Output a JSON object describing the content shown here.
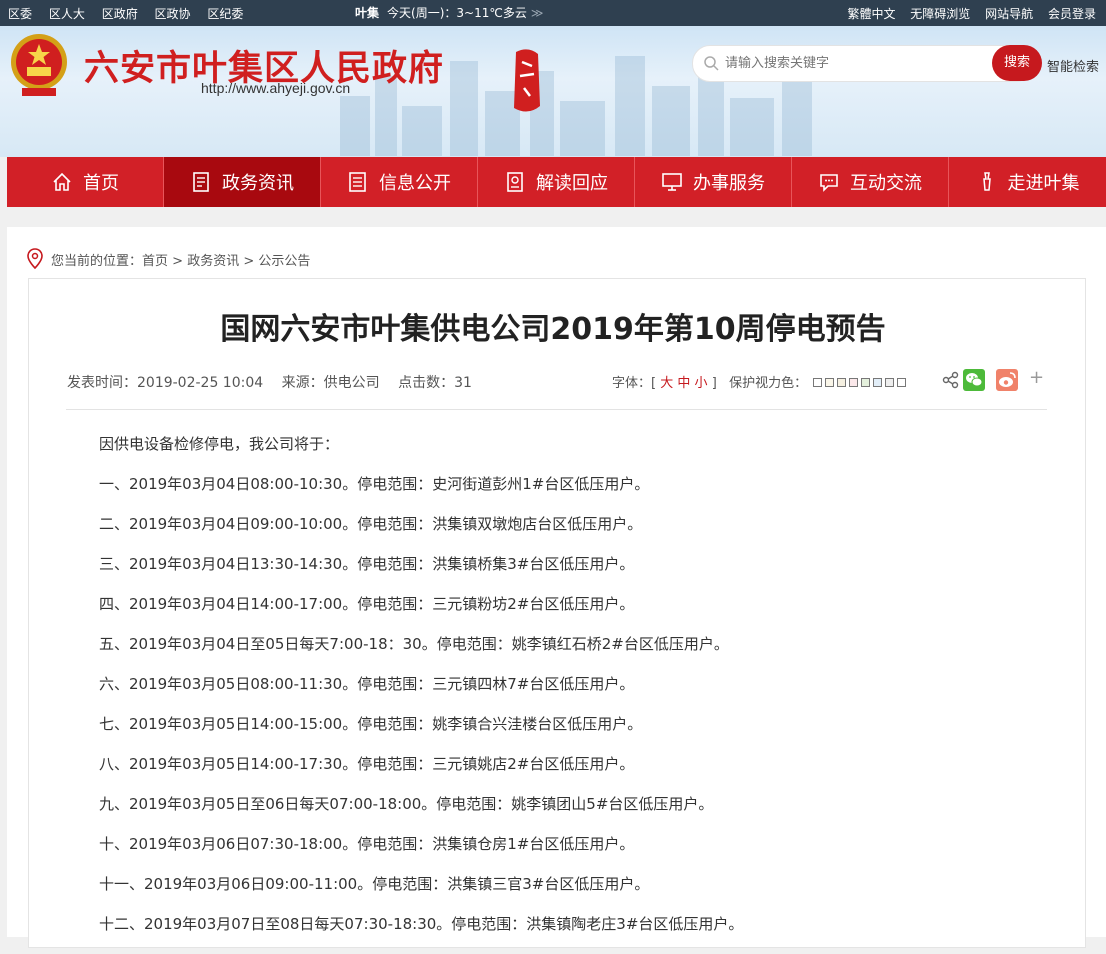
{
  "topbar": {
    "links": [
      "区委",
      "区人大",
      "区政府",
      "区政协",
      "区纪委"
    ],
    "weather_place": "叶集",
    "weather_text": "今天(周一)：3~11℃多云",
    "arrow": "≫",
    "right_links": [
      "繁體中文",
      "无障碍浏览",
      "网站导航",
      "会员登录"
    ]
  },
  "header": {
    "title": "六安市叶集区人民政府",
    "url": "http://www.ahyeji.gov.cn"
  },
  "search": {
    "placeholder": "请输入搜索关键字",
    "button": "搜索",
    "smart": "智能检索"
  },
  "nav": [
    {
      "label": "首页",
      "icon": "home-icon"
    },
    {
      "label": "政务资讯",
      "icon": "document-icon"
    },
    {
      "label": "信息公开",
      "icon": "list-icon"
    },
    {
      "label": "解读回应",
      "icon": "badge-icon"
    },
    {
      "label": "办事服务",
      "icon": "monitor-icon"
    },
    {
      "label": "互动交流",
      "icon": "chat-icon"
    },
    {
      "label": "走进叶集",
      "icon": "landmark-icon"
    }
  ],
  "breadcrumb": {
    "prefix": "您当前的位置：",
    "items": [
      "首页",
      "政务资讯",
      "公示公告"
    ],
    "sep": " > "
  },
  "article": {
    "title": "国网六安市叶集供电公司2019年第10周停电预告",
    "publish_time": "发表时间：2019-02-25 10:04",
    "source": "来源：供电公司",
    "clicks": "点击数：31",
    "font_label": "字体：",
    "font_sizes": [
      "大",
      "中",
      "小"
    ],
    "eye_label": "保护视力色：",
    "lines": [
      "因供电设备检修停电，我公司将于：",
      "一、2019年03月04日08:00-10:30。停电范围：史河街道彭州1#台区低压用户。",
      "二、2019年03月04日09:00-10:00。停电范围：洪集镇双墩炮店台区低压用户。",
      "三、2019年03月04日13:30-14:30。停电范围：洪集镇桥集3#台区低压用户。",
      "四、2019年03月04日14:00-17:00。停电范围：三元镇粉坊2#台区低压用户。",
      "五、2019年03月04日至05日每天7:00-18：30。停电范围：姚李镇红石桥2#台区低压用户。",
      "六、2019年03月05日08:00-11:30。停电范围：三元镇四林7#台区低压用户。",
      "七、2019年03月05日14:00-15:00。停电范围：姚李镇合兴洼楼台区低压用户。",
      "八、2019年03月05日14:00-17:30。停电范围：三元镇姚店2#台区低压用户。",
      "九、2019年03月05日至06日每天07:00-18:00。停电范围：姚李镇团山5#台区低压用户。",
      "十、2019年03月06日07:30-18:00。停电范围：洪集镇仓房1#台区低压用户。",
      "十一、2019年03月06日09:00-11:00。停电范围：洪集镇三官3#台区低压用户。",
      "十二、2019年03月07日至08日每天07:30-18:30。停电范围：洪集镇陶老庄3#台区低压用户。"
    ]
  },
  "colors": {
    "nav_red": "#d22027",
    "nav_active": "#a8090f",
    "title_red": "#d01f1f",
    "topbar": "#2f4050"
  }
}
